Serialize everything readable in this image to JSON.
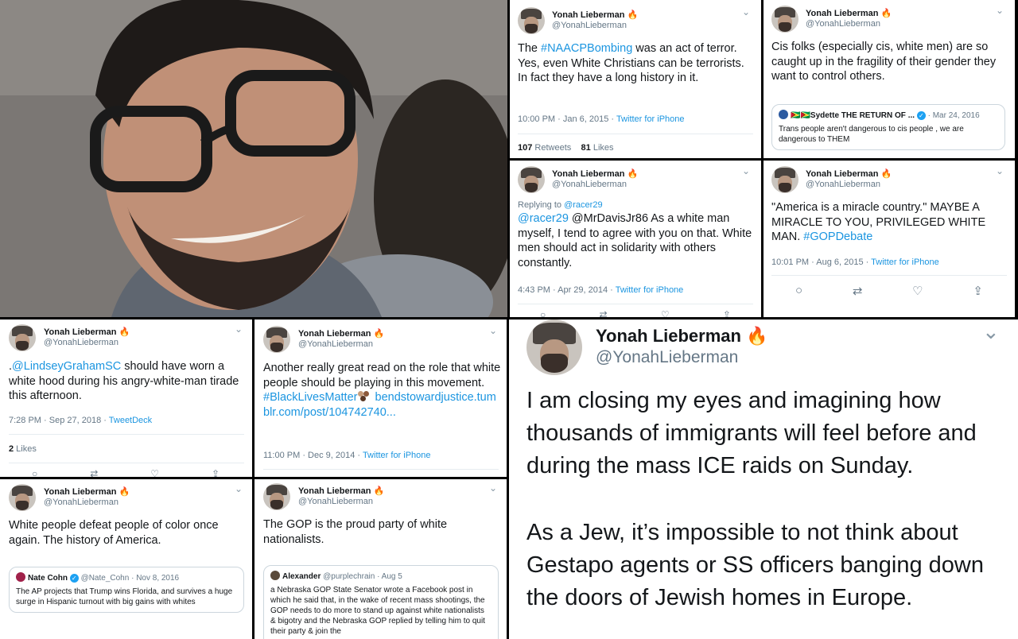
{
  "user": {
    "name": "Yonah Lieberman",
    "handle": "@YonahLieberman",
    "badge": "🔥"
  },
  "icons": {
    "chevron": "chevron-down-icon",
    "reply": "reply-icon",
    "retweet": "retweet-icon",
    "like": "heart-icon",
    "share": "share-icon"
  },
  "tweets": [
    {
      "text_parts": [
        "The ",
        "#NAACPBombing",
        " was an act of terror. Yes, even White Christians can be terrorists. In fact they have a long history in it."
      ],
      "time": "10:00 PM · Jan 6, 2015 · ",
      "source": "Twitter for iPhone",
      "retweets": "107",
      "retweets_label": " Retweets",
      "likes": "81",
      "likes_label": " Likes"
    },
    {
      "text": "Cis folks (especially cis, white men) are so caught up in the fragility of their gender they want to control others.",
      "quote": {
        "flags": "🇬🇾🇬🇾",
        "name": "Sydette THE RETURN OF ...",
        "date": "· Mar 24, 2016",
        "text": "Trans people aren't dangerous to cis people , we are dangerous to THEM"
      }
    },
    {
      "replying_label": "Replying to ",
      "replying_to": "@racer29",
      "mention": "@racer29",
      "text": " @MrDavisJr86 As a white man myself, I tend to agree with you on that. White men should act in solidarity with others constantly.",
      "time": "4:43 PM · Apr 29, 2014 · ",
      "source": "Twitter for iPhone"
    },
    {
      "text": "\"America is a miracle country.\" MAYBE A MIRACLE TO YOU, PRIVILEGED WHITE MAN. ",
      "hashtag": "#GOPDebate",
      "time": "10:01 PM · Aug 6, 2015 · ",
      "source": "Twitter for iPhone"
    },
    {
      "prefix": ".",
      "mention": "@LindseyGrahamSC",
      "text": " should have worn a white hood during his angry-white-man tirade this afternoon.",
      "time": "7:28 PM · Sep 27, 2018 · ",
      "source": "TweetDeck",
      "likes": "2",
      "likes_label": " Likes"
    },
    {
      "text": "Another really great read on the role that white people should be playing in this movement. ",
      "hashtag": "#BlackLivesMatter",
      "link": "bendstowardjustice.tumblr.com/post/104742740...",
      "time": "11:00 PM · Dec 9, 2014 · ",
      "source": "Twitter for iPhone"
    },
    {
      "text": "White people defeat people of color once again. The history of America.",
      "quote": {
        "name": "Nate Cohn",
        "handle": "@Nate_Cohn · Nov 8, 2016",
        "text": "The AP projects that Trump wins Florida, and survives a huge surge in Hispanic turnout with big gains with whites"
      }
    },
    {
      "text": "The GOP is the proud party of white nationalists.",
      "quote": {
        "name": "Alexander",
        "handle": "@purplechrain · Aug 5",
        "text": "a Nebraska GOP State Senator wrote a Facebook post in which he said that, in the wake of recent mass shootings, the GOP needs to do more to stand up against white nationalists & bigotry and the Nebraska GOP replied by telling him to quit their party & join the"
      }
    },
    {
      "text": "I am closing my eyes and imagining how thousands of immigrants will feel before and during the mass ICE raids on Sunday.",
      "text2": "As a Jew, it’s impossible to not think about Gestapo agents or SS officers banging down the doors of Jewish homes in Europe."
    }
  ]
}
